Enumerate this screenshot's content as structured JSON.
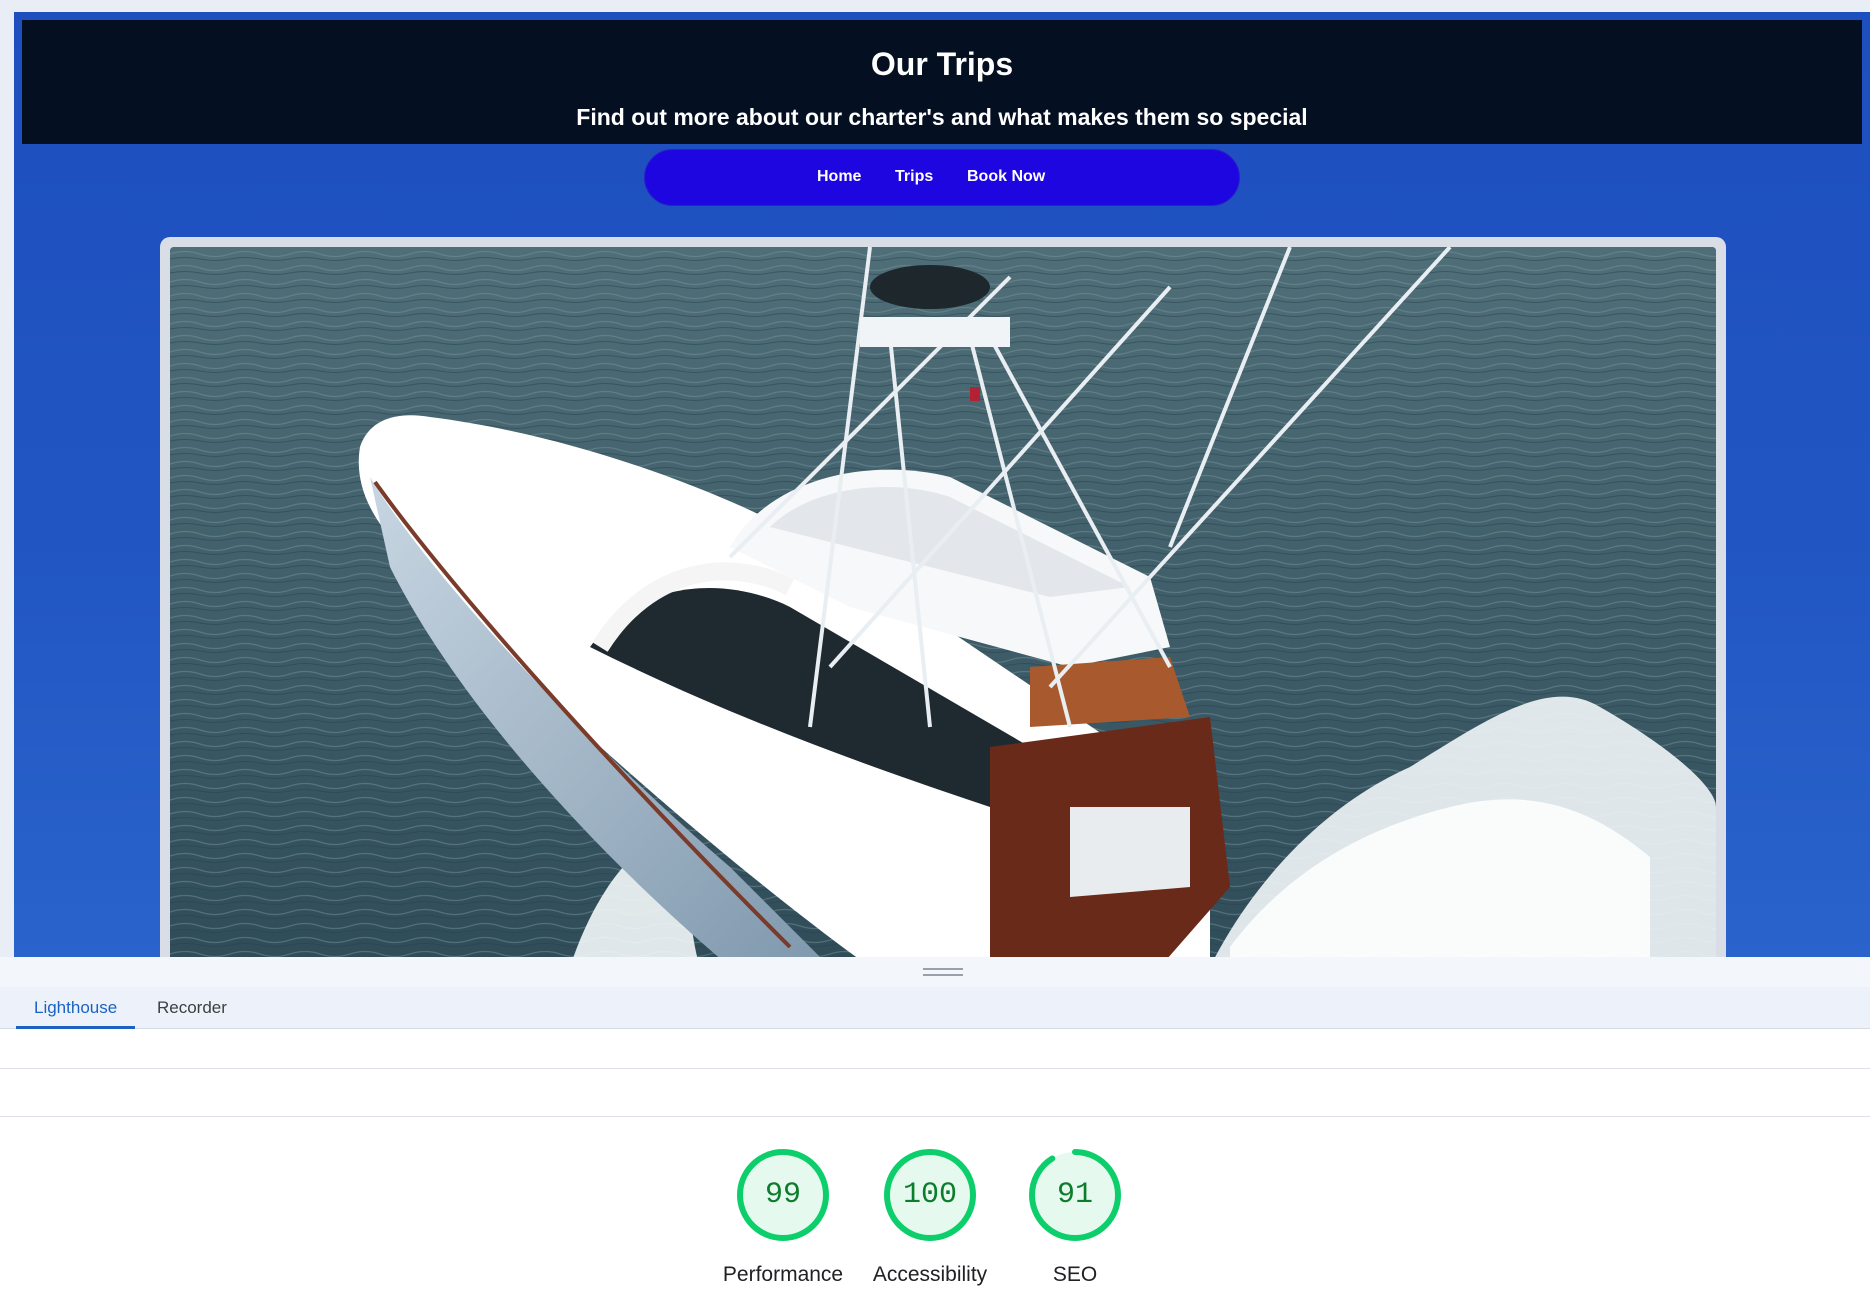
{
  "site": {
    "title": "Our Trips",
    "subtitle": "Find out more about our charter's and what makes them so special",
    "nav": [
      {
        "label": "Home"
      },
      {
        "label": "Trips"
      },
      {
        "label": "Book Now"
      }
    ],
    "hero_image": "sportfishing-yacht-aerial-photo"
  },
  "devtools": {
    "tabs": [
      {
        "label": "Lighthouse",
        "active": true
      },
      {
        "label": "Recorder",
        "active": false
      }
    ],
    "scores": [
      {
        "label": "Performance",
        "value": "99",
        "fraction": 0.99
      },
      {
        "label": "Accessibility",
        "value": "100",
        "fraction": 1.0
      },
      {
        "label": "SEO",
        "value": "91",
        "fraction": 0.91
      }
    ],
    "score_color": "#0cce6b",
    "score_bg": "#e6f9ee"
  },
  "colors": {
    "header_bg": "#050f22",
    "page_bg": "#1d4fbe",
    "nav_bg": "#1e06e0",
    "tab_accent": "#1a63c4"
  }
}
